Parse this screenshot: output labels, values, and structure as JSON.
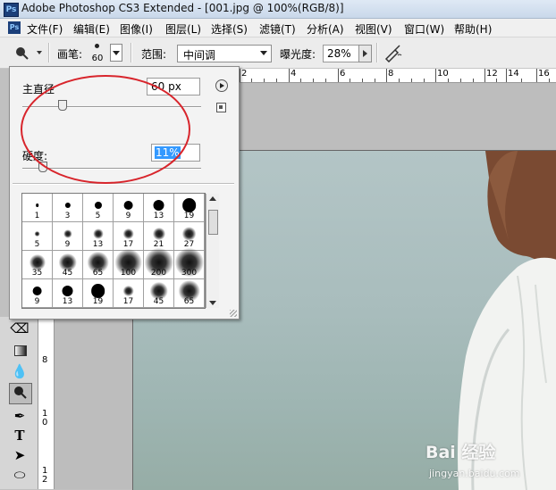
{
  "window": {
    "ps_logo": "Ps",
    "title": "Adobe Photoshop CS3 Extended - [001.jpg @ 100%(RGB/8)]"
  },
  "menu": {
    "ps_logo": "Ps",
    "items": [
      "文件(F)",
      "编辑(E)",
      "图像(I)",
      "图层(L)",
      "选择(S)",
      "滤镜(T)",
      "分析(A)",
      "视图(V)",
      "窗口(W)",
      "帮助(H)"
    ]
  },
  "options_bar": {
    "tool_icon": "sponge-icon",
    "brush_label": "画笔:",
    "brush_size": "60",
    "range_label": "范围:",
    "range_value": "中间调",
    "exposure_label": "曝光度:",
    "exposure_value": "28%",
    "airbrush_icon": "airbrush-icon"
  },
  "ruler": {
    "top_labels": [
      "2",
      "4",
      "6",
      "8",
      "10",
      "12",
      "14",
      "16"
    ],
    "left_labels": [
      "8",
      "1 0",
      "1 2"
    ]
  },
  "brush_panel": {
    "diameter_label": "主直径",
    "diameter_value": "60 px",
    "diameter_fraction": 0.22,
    "hardness_label": "硬度:",
    "hardness_value": "11%",
    "hardness_fraction": 0.11,
    "presets": [
      {
        "size": "1"
      },
      {
        "size": "3"
      },
      {
        "size": "5"
      },
      {
        "size": "9"
      },
      {
        "size": "13"
      },
      {
        "size": "19"
      },
      {
        "size": "5"
      },
      {
        "size": "9"
      },
      {
        "size": "13"
      },
      {
        "size": "17"
      },
      {
        "size": "21"
      },
      {
        "size": "27"
      },
      {
        "size": "35"
      },
      {
        "size": "45"
      },
      {
        "size": "65"
      },
      {
        "size": "100"
      },
      {
        "size": "200"
      },
      {
        "size": "300"
      },
      {
        "size": "9"
      },
      {
        "size": "13"
      },
      {
        "size": "19"
      },
      {
        "size": "17"
      },
      {
        "size": "45"
      },
      {
        "size": "65"
      }
    ]
  },
  "watermark": {
    "brand": "Bai 经验",
    "url": "jingyan.baidu.com"
  },
  "colors": {
    "annotation_circle": "#d8252c",
    "selected_text_bg": "#3399ff"
  }
}
